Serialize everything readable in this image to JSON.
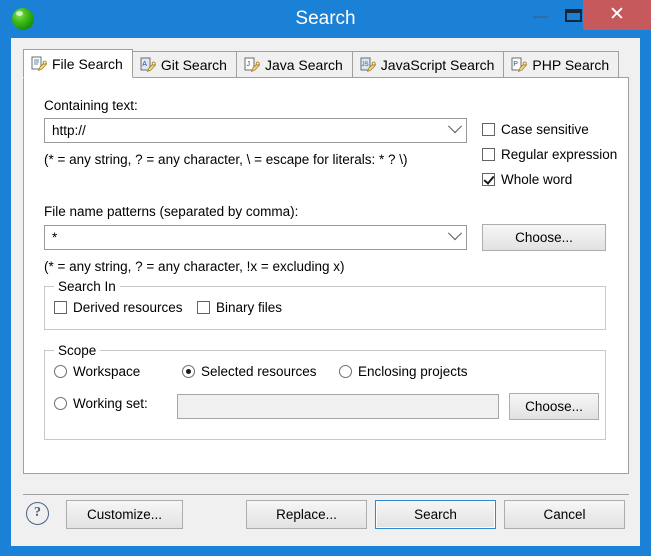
{
  "window": {
    "title": "Search",
    "app_icon": "eclipse-sphere-icon",
    "minimize_label": "–",
    "maximize_label": "□",
    "close_label": "✕",
    "titlebar_color": "#1a81d6",
    "close_button_color": "#c5595c"
  },
  "tabs": [
    {
      "label": "File Search",
      "icon": "file-search-icon",
      "selected": true
    },
    {
      "label": "Git Search",
      "icon": "git-search-icon",
      "selected": false
    },
    {
      "label": "Java Search",
      "icon": "java-search-icon",
      "selected": false
    },
    {
      "label": "JavaScript Search",
      "icon": "javascript-search-icon",
      "selected": false
    },
    {
      "label": "PHP Search",
      "icon": "php-search-icon",
      "selected": false
    }
  ],
  "file_search": {
    "containing_text_label": "Containing text:",
    "containing_text_value": "http://",
    "containing_text_hint": "(* = any string, ? = any character, \\ = escape for literals: * ? \\)",
    "options": [
      {
        "label": "Case sensitive",
        "checked": false
      },
      {
        "label": "Regular expression",
        "checked": false
      },
      {
        "label": "Whole word",
        "checked": true
      }
    ],
    "file_patterns_label": "File name patterns (separated by comma):",
    "file_patterns_value": "*",
    "file_patterns_hint": "(* = any string, ? = any character, !x = excluding x)",
    "choose_patterns_label": "Choose...",
    "search_in": {
      "title": "Search In",
      "options": [
        {
          "label": "Derived resources",
          "checked": false
        },
        {
          "label": "Binary files",
          "checked": false
        }
      ]
    },
    "scope": {
      "title": "Scope",
      "radios": [
        {
          "label": "Workspace",
          "selected": false
        },
        {
          "label": "Selected resources",
          "selected": true
        },
        {
          "label": "Enclosing projects",
          "selected": false
        },
        {
          "label": "Working set:",
          "selected": false
        }
      ],
      "working_set_value": "",
      "choose_label": "Choose..."
    }
  },
  "footer": {
    "help_label": "?",
    "customize_label": "Customize...",
    "replace_label": "Replace...",
    "search_label": "Search",
    "cancel_label": "Cancel",
    "default_button_accent": "#2a8ad4"
  }
}
